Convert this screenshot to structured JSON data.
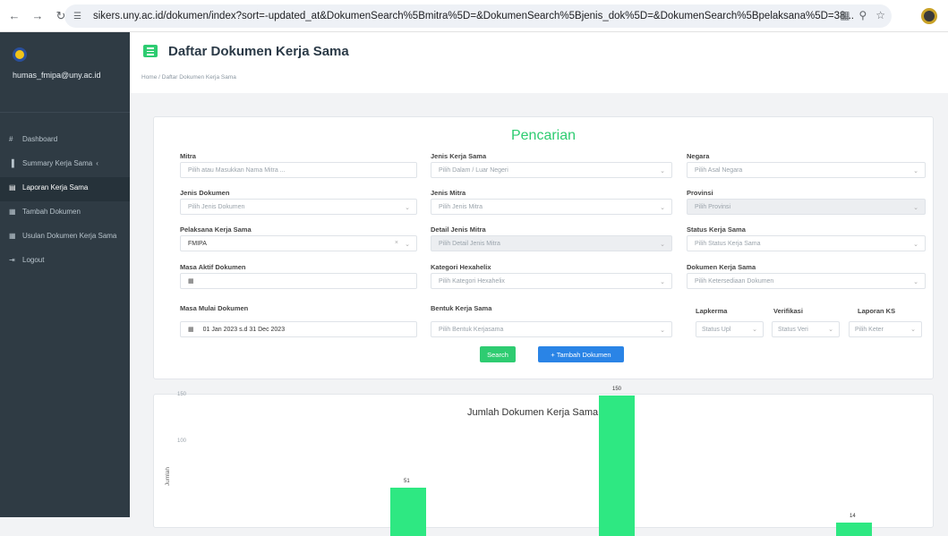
{
  "browser": {
    "url": "sikers.uny.ac.id/dokumen/index?sort=-updated_at&DokumenSearch%5Bmitra%5D=&DokumenSearch%5Bjenis_dok%5D=&DokumenSearch%5Bpelaksana%5D=38..."
  },
  "sidebar": {
    "user": "humas_fmipa@uny.ac.id",
    "items": [
      {
        "icon": "dashboard-icon",
        "glyph": "#",
        "label": "Dashboard"
      },
      {
        "icon": "bar-chart-icon",
        "glyph": "▐",
        "label": "Summary Kerja Sama",
        "chevron": "‹"
      },
      {
        "icon": "report-icon",
        "glyph": "▤",
        "label": "Laporan Kerja Sama"
      },
      {
        "icon": "table-icon",
        "glyph": "▦",
        "label": "Tambah Dokumen"
      },
      {
        "icon": "table-icon",
        "glyph": "▦",
        "label": "Usulan Dokumen Kerja Sama"
      },
      {
        "icon": "logout-icon",
        "glyph": "⇥",
        "label": "Logout"
      }
    ]
  },
  "header": {
    "title": "Daftar Dokumen Kerja Sama",
    "breadcrumb": "Home  /  Daftar Dokumen Kerja Sama"
  },
  "search": {
    "title": "Pencarian",
    "fields": {
      "mitra": {
        "label": "Mitra",
        "placeholder": "Pilih atau Masukkan Nama Mitra ..."
      },
      "jenis_kerja_sama": {
        "label": "Jenis Kerja Sama",
        "placeholder": "Pilih Dalam / Luar Negeri"
      },
      "negara": {
        "label": "Negara",
        "placeholder": "Pilih Asal Negara"
      },
      "jenis_dokumen": {
        "label": "Jenis Dokumen",
        "placeholder": "Pilih Jenis Dokumen"
      },
      "jenis_mitra": {
        "label": "Jenis Mitra",
        "placeholder": "Pilih Jenis Mitra"
      },
      "provinsi": {
        "label": "Provinsi",
        "placeholder": "Pilih Provinsi"
      },
      "pelaksana": {
        "label": "Pelaksana Kerja Sama",
        "value": "FMIPA"
      },
      "detail_jenis_mitra": {
        "label": "Detail Jenis Mitra",
        "placeholder": "Pilih Detail Jenis Mitra"
      },
      "status_kerja_sama": {
        "label": "Status Kerja Sama",
        "placeholder": "Pilih Status Kerja Sama"
      },
      "masa_aktif": {
        "label": "Masa Aktif Dokumen",
        "value": ""
      },
      "kategori_hexahelix": {
        "label": "Kategori Hexahelix",
        "placeholder": "Pilih Kategori Hexahelix"
      },
      "dokumen_kerja_sama": {
        "label": "Dokumen Kerja Sama",
        "placeholder": "Pilih Ketersediaan Dokumen"
      },
      "masa_mulai": {
        "label": "Masa Mulai Dokumen",
        "value": "01 Jan 2023 s.d 31 Dec 2023"
      },
      "bentuk_kerja_sama": {
        "label": "Bentuk Kerja Sama",
        "placeholder": "Pilih Bentuk Kerjasama"
      },
      "lapkerma": {
        "label": "Lapkerma",
        "placeholder": "Status Upl"
      },
      "verifikasi": {
        "label": "Verifikasi",
        "placeholder": "Status Veri"
      },
      "laporan_ks": {
        "label": "Laporan KS",
        "placeholder": "Pilih Keter"
      }
    },
    "search_button": "Search",
    "add_button": "+ Tambah Dokumen"
  },
  "chart": {
    "title": "Jumlah Dokumen Kerja Sama Aktif",
    "ylabel": "Jumlah"
  },
  "chart_data": {
    "type": "bar",
    "title": "Jumlah Dokumen Kerja Sama Aktif",
    "ylabel": "Jumlah",
    "xlabel": "",
    "y_ticks": [
      100,
      150
    ],
    "ylim": [
      0,
      200
    ],
    "values": [
      51,
      150,
      14
    ],
    "value_labels": [
      "51",
      "150",
      "14"
    ]
  }
}
